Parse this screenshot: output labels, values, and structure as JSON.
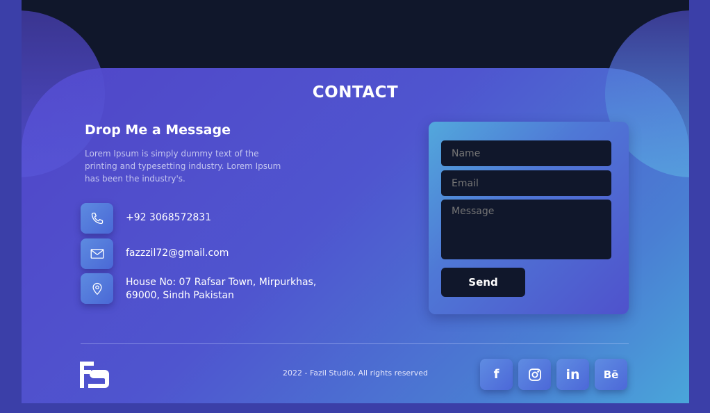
{
  "section": {
    "title": "CONTACT"
  },
  "intro": {
    "heading": "Drop Me a Message",
    "description": "Lorem Ipsum is simply dummy text of the printing and typesetting industry. Lorem Ipsum has been the industry's."
  },
  "contact_info": {
    "phone": "+92 3068572831",
    "email": "fazzzil72@gmail.com",
    "address_line1": "House No: 07 Rafsar Town, Mirpurkhas,",
    "address_line2": "69000, Sindh Pakistan",
    "icons": [
      "phone-icon",
      "mail-icon",
      "location-pin-icon"
    ]
  },
  "form": {
    "name_placeholder": "Name",
    "email_placeholder": "Email",
    "message_placeholder": "Message",
    "send_label": "Send"
  },
  "footer": {
    "copyright": "2022 - Fazil Studio, All rights reserved",
    "logo_icon": "fs-logo-icon",
    "socials": {
      "facebook": "f",
      "instagram": "instagram-icon",
      "linkedin": "in",
      "behance": "Bē"
    }
  },
  "colors": {
    "page_bg": "#3b3fa8",
    "dark": "#10172b",
    "panel_start": "#5146c8",
    "panel_end": "#4aa6da",
    "text_muted": "#c3c4ef"
  }
}
